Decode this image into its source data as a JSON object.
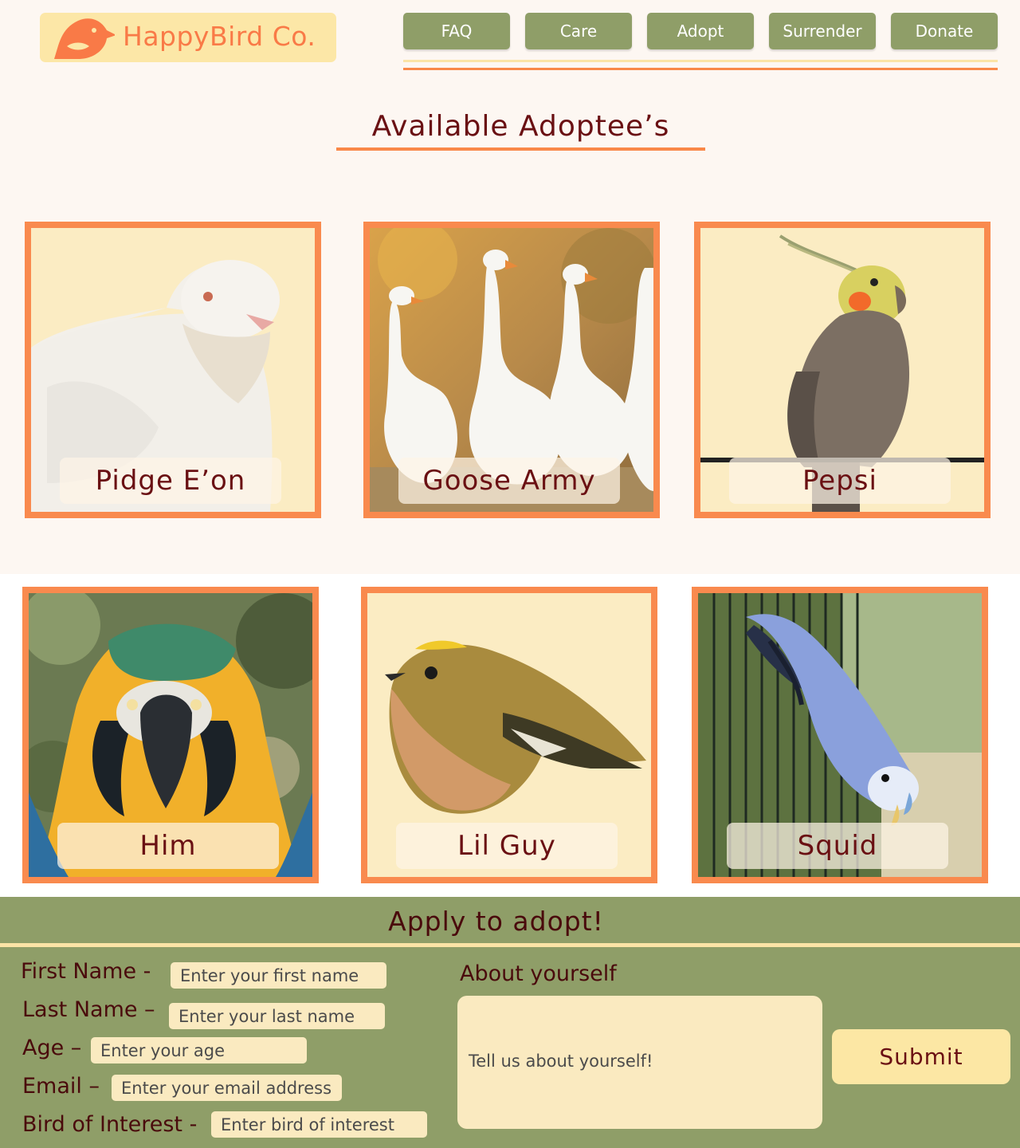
{
  "brand": {
    "name": "HappyBird Co."
  },
  "nav": {
    "items": [
      "FAQ",
      "Care",
      "Adopt",
      "Surrender",
      "Donate"
    ]
  },
  "page": {
    "heading": "Available Adoptee’s"
  },
  "birds": [
    {
      "name": "Pidge E’on",
      "image": "white-pigeon"
    },
    {
      "name": "Goose Army",
      "image": "white-geese"
    },
    {
      "name": "Pepsi",
      "image": "cockatiel"
    },
    {
      "name": "Him",
      "image": "blue-gold-macaw"
    },
    {
      "name": "Lil Guy",
      "image": "goldcrest"
    },
    {
      "name": "Squid",
      "image": "blue-budgie"
    }
  ],
  "form": {
    "title": "Apply to adopt!",
    "first_name_label": "First Name -",
    "first_name_placeholder": "Enter your first name",
    "last_name_label": "Last Name –",
    "last_name_placeholder": "Enter your last name",
    "age_label": "Age –",
    "age_placeholder": "Enter your age",
    "email_label": "Email –",
    "email_placeholder": "Enter your email address",
    "bird_label": "Bird of Interest -",
    "bird_placeholder": "Enter bird of interest",
    "about_label": "About yourself",
    "about_placeholder": "Tell us about yourself!",
    "submit_label": "Submit"
  },
  "colors": {
    "accent_orange": "#f98848",
    "nav_green": "#8f9e68",
    "heading_maroon": "#6a1013",
    "cream": "#fbecc3",
    "page_background": "#fdf7f2"
  }
}
